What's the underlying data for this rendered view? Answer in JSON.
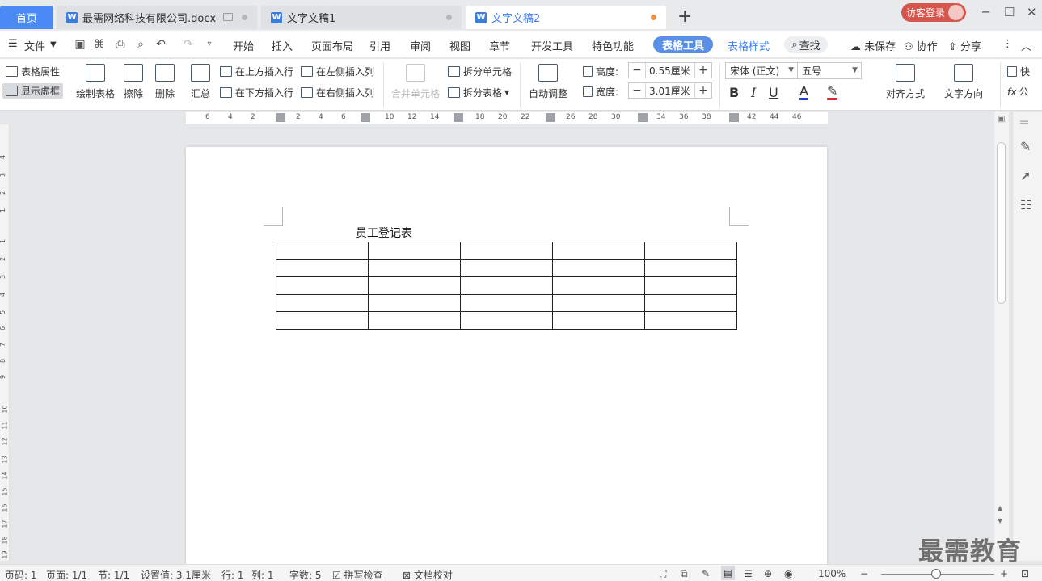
{
  "tabs": {
    "home": "首页",
    "docs": [
      {
        "name": "最需网络科技有限公司.docx"
      },
      {
        "name": "文字文稿1"
      },
      {
        "name": "文字文稿2"
      }
    ],
    "new_tab": "+",
    "guest_login": "访客登录"
  },
  "menu": {
    "file": "文件",
    "items": [
      "开始",
      "插入",
      "页面布局",
      "引用",
      "审阅",
      "视图",
      "章节",
      "开发工具",
      "特色功能"
    ],
    "table_tools": "表格工具",
    "table_style": "表格样式",
    "search": "查找",
    "unsaved": "未保存",
    "collab": "协作",
    "share": "分享"
  },
  "ribbon": {
    "table_props": "表格属性",
    "show_gridlines": "显示虚框",
    "draw_table": "绘制表格",
    "erase": "擦除",
    "delete": "删除",
    "summary": "汇总",
    "insert_above": "在上方插入行",
    "insert_below": "在下方插入行",
    "insert_left": "在左侧插入列",
    "insert_right": "在右侧插入列",
    "merge_cells": "合并单元格",
    "split_cells": "拆分单元格",
    "split_table": "拆分表格",
    "auto_fit": "自动调整",
    "height_label": "高度:",
    "height_value": "0.55厘米",
    "width_label": "宽度:",
    "width_value": "3.01厘米",
    "font_name": "宋体 (正文)",
    "font_size": "五号",
    "bold": "B",
    "italic": "I",
    "underline": "U",
    "font_color": "A",
    "align": "对齐方式",
    "text_direction": "文字方向",
    "quick": "快",
    "formula": "公"
  },
  "ruler": {
    "h_ticks": [
      "6",
      "4",
      "2",
      "2",
      "4",
      "6",
      "10",
      "12",
      "14",
      "18",
      "20",
      "22",
      "26",
      "28",
      "30",
      "34",
      "36",
      "38",
      "42",
      "44",
      "46"
    ],
    "v_ticks": [
      "4",
      "3",
      "2",
      "1",
      "1",
      "2",
      "3",
      "4",
      "5",
      "6",
      "7",
      "8",
      "9",
      "10",
      "11",
      "12",
      "13",
      "14",
      "15",
      "16",
      "17",
      "18",
      "19"
    ]
  },
  "document": {
    "title": "员工登记表",
    "table": {
      "rows": 5,
      "cols": 5
    }
  },
  "status": {
    "page_num": "页码: 1",
    "pages": "页面: 1/1",
    "section": "节: 1/1",
    "setting": "设置值: 3.1厘米",
    "row": "行: 1",
    "col": "列: 1",
    "words": "字数: 5",
    "spell_check": "拼写检查",
    "doc_proof": "文档校对",
    "zoom": "100%"
  },
  "watermark": "最需教育",
  "colors": {
    "accent": "#4a8af4",
    "guest": "#d6564e",
    "table_tools_pill": "#5a8fe8",
    "unsaved_dot": "#f0903c"
  }
}
